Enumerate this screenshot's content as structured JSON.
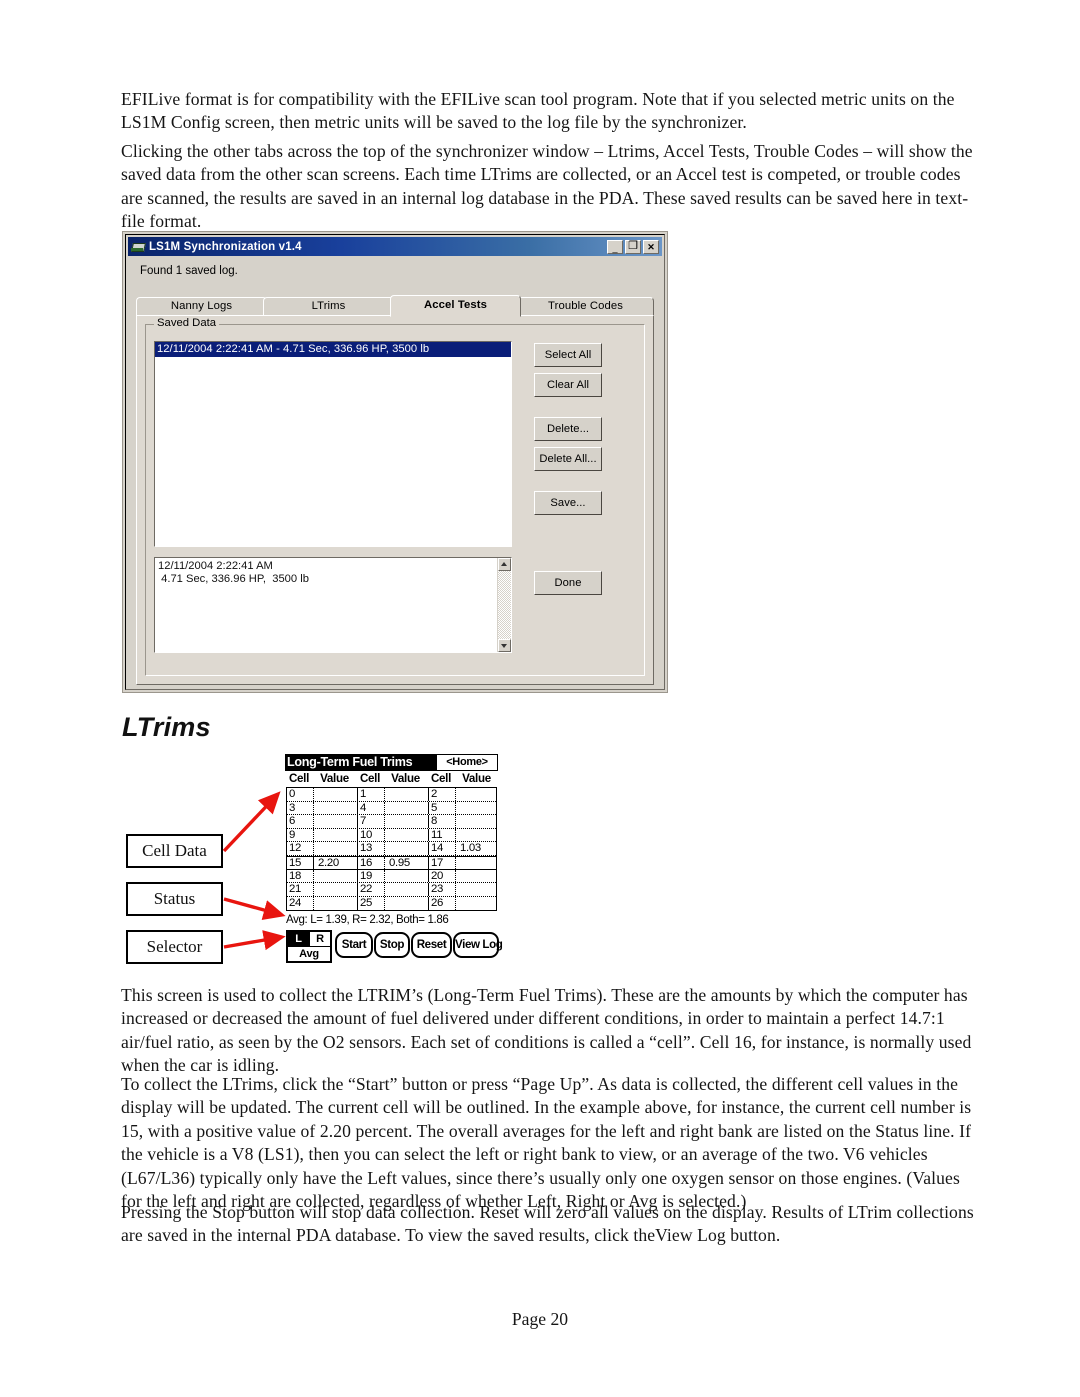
{
  "document": {
    "paragraphs": {
      "efilive": "EFILive format is for compatibility with the EFILive scan tool program.  Note that if you selected metric units on the LS1M Config screen, then metric units will be saved to the log file by the synchronizer.",
      "clicking": "Clicking the other tabs across the top of the synchronizer window – Ltrims, Accel Tests, Trouble Codes – will show the saved data from the other scan screens.  Each time LTrims are collected, or an Accel test is competed, or trouble codes are scanned, the results are saved in an internal log database in the PDA.  These saved results can be saved here in text-file format.",
      "screen_use": "This screen is used to collect the LTRIM’s (Long-Term Fuel Trims).  These are the amounts by which the computer has increased or decreased the amount of fuel delivered under different conditions, in order to maintain a perfect 14.7:1 air/fuel ratio, as seen by the O2 sensors.  Each set of conditions is called a “cell”.  Cell 16, for instance, is normally used when the car is idling.",
      "collect": "To collect the LTrims, click the “Start” button or press “Page Up”.  As data is collected, the different cell values in the display will be updated.  The current cell will be outlined.  In the example above, for instance, the current cell number is 15, with a positive value of 2.20 percent.  The overall averages for the left and right bank are listed on the Status line.  If the vehicle is a V8 (LS1), then you can select the left or right bank to view, or an average of the two.  V6 vehicles (L67/L36) typically only have the Left values, since there’s usually only one oxygen sensor on those engines.  (Values for the left and right are collected, regardless of whether Left, Right or Avg is selected.)",
      "stopping": "Pressing the Stop button will stop data collection.  Reset will zero all values on the display.  Results of LTrim collections are saved in the internal PDA database.  To view the saved results, click theView Log button."
    },
    "section_heading": "LTrims",
    "footer": "Page 20"
  },
  "sync_window": {
    "title": "LS1M Synchronization v1.4",
    "title_icon": "app-icon",
    "window_buttons": {
      "minimize": "_",
      "maximize": "❐",
      "close": "✕"
    },
    "status_text": "Found 1 saved log.",
    "tabs": [
      {
        "label": "Nanny Logs",
        "active": false
      },
      {
        "label": "LTrims",
        "active": false
      },
      {
        "label": "Accel Tests",
        "active": true
      },
      {
        "label": "Trouble Codes",
        "active": false
      }
    ],
    "group_label": "Saved Data",
    "list": {
      "selected_item": "12/11/2004 2:22:41 AM -  4.71 Sec, 336.96 HP,  3500 lb"
    },
    "detail_text": "12/11/2004 2:22:41 AM\n 4.71 Sec, 336.96 HP,  3500 lb",
    "buttons": {
      "select_all": "Select All",
      "clear_all": "Clear All",
      "delete": "Delete...",
      "delete_all": "Delete All...",
      "save": "Save...",
      "done": "Done"
    },
    "colors": {
      "titlebar_start": "#0a246a",
      "titlebar_end": "#6b96c8",
      "face": "#d6d2ca",
      "selection": "#0a1e79"
    }
  },
  "pda_screen": {
    "title": "Long-Term Fuel Trims",
    "home_button": "<Home>",
    "column_headers": [
      "Cell",
      "Value",
      "Cell",
      "Value",
      "Cell",
      "Value"
    ],
    "rows": [
      {
        "cells": [
          {
            "num": "0",
            "val": ""
          },
          {
            "num": "1",
            "val": ""
          },
          {
            "num": "2",
            "val": ""
          }
        ]
      },
      {
        "cells": [
          {
            "num": "3",
            "val": ""
          },
          {
            "num": "4",
            "val": ""
          },
          {
            "num": "5",
            "val": ""
          }
        ]
      },
      {
        "cells": [
          {
            "num": "6",
            "val": ""
          },
          {
            "num": "7",
            "val": ""
          },
          {
            "num": "8",
            "val": ""
          }
        ]
      },
      {
        "cells": [
          {
            "num": "9",
            "val": ""
          },
          {
            "num": "10",
            "val": ""
          },
          {
            "num": "11",
            "val": ""
          }
        ]
      },
      {
        "cells": [
          {
            "num": "12",
            "val": ""
          },
          {
            "num": "13",
            "val": ""
          },
          {
            "num": "14",
            "val": "1.03"
          }
        ]
      },
      {
        "selected": true,
        "cells": [
          {
            "num": "15",
            "val": "2.20",
            "highlighted": true
          },
          {
            "num": "16",
            "val": "0.95"
          },
          {
            "num": "17",
            "val": ""
          }
        ]
      },
      {
        "cells": [
          {
            "num": "18",
            "val": ""
          },
          {
            "num": "19",
            "val": ""
          },
          {
            "num": "20",
            "val": ""
          }
        ]
      },
      {
        "cells": [
          {
            "num": "21",
            "val": ""
          },
          {
            "num": "22",
            "val": ""
          },
          {
            "num": "23",
            "val": ""
          }
        ]
      },
      {
        "cells": [
          {
            "num": "24",
            "val": ""
          },
          {
            "num": "25",
            "val": ""
          },
          {
            "num": "26",
            "val": ""
          }
        ]
      }
    ],
    "status_line": "Avg: L= 1.39, R= 2.32, Both= 1.86",
    "selector": {
      "left": "L",
      "right": "R",
      "avg": "Avg",
      "selected": "L"
    },
    "buttons": {
      "start": "Start",
      "stop": "Stop",
      "reset": "Reset",
      "view_log": "View Log"
    }
  },
  "callouts": {
    "cell_data": "Cell Data",
    "status": "Status",
    "selector": "Selector",
    "arrow_color": "#e8150f"
  }
}
